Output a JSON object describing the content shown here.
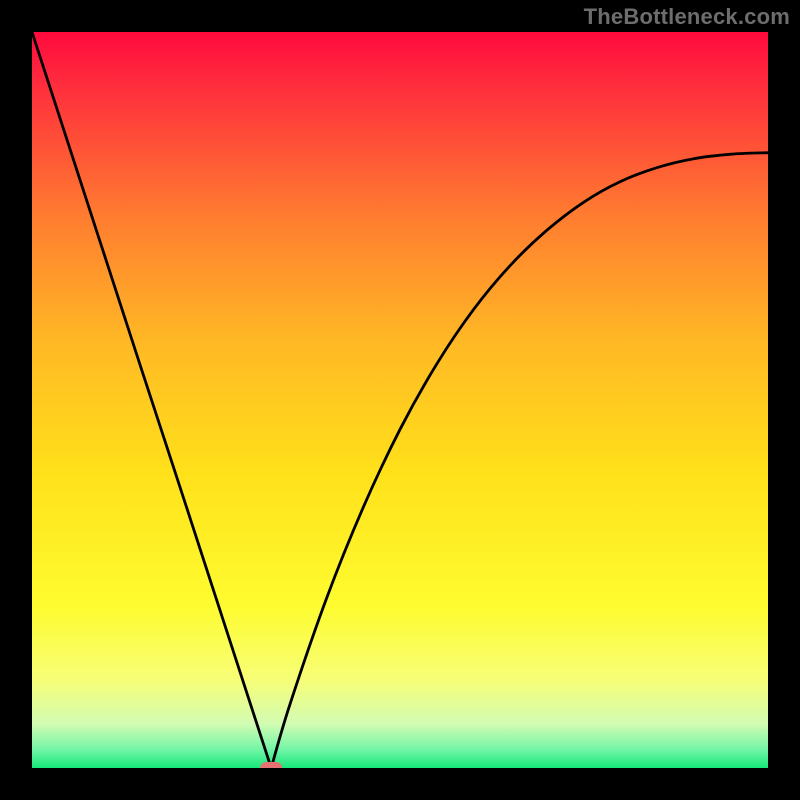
{
  "watermark": "TheBottleneck.com",
  "chart_data": {
    "type": "line",
    "title": "",
    "xlabel": "",
    "ylabel": "",
    "xlim": [
      0,
      1
    ],
    "ylim": [
      0,
      1
    ],
    "vertex_x": 0.325,
    "x": [
      0.0,
      0.05,
      0.1,
      0.15,
      0.2,
      0.25,
      0.3,
      0.325,
      0.35,
      0.4,
      0.45,
      0.5,
      0.55,
      0.6,
      0.65,
      0.7,
      0.75,
      0.8,
      0.85,
      0.9,
      0.95,
      1.0
    ],
    "values": [
      1.0,
      0.846,
      0.692,
      0.538,
      0.385,
      0.231,
      0.077,
      0.0,
      0.085,
      0.23,
      0.354,
      0.46,
      0.549,
      0.623,
      0.683,
      0.731,
      0.769,
      0.797,
      0.816,
      0.828,
      0.834,
      0.836
    ],
    "axes_visible": false,
    "legend": false,
    "background": "vertical-gradient",
    "gradient_stops": [
      {
        "offset": 0.0,
        "color": "#ff0a3d"
      },
      {
        "offset": 0.07,
        "color": "#ff2c3d"
      },
      {
        "offset": 0.25,
        "color": "#ff7c30"
      },
      {
        "offset": 0.42,
        "color": "#ffb825"
      },
      {
        "offset": 0.6,
        "color": "#ffe11a"
      },
      {
        "offset": 0.78,
        "color": "#fefc30"
      },
      {
        "offset": 0.88,
        "color": "#f7fe77"
      },
      {
        "offset": 0.94,
        "color": "#d2fcb3"
      },
      {
        "offset": 0.975,
        "color": "#73f5a7"
      },
      {
        "offset": 1.0,
        "color": "#15e87a"
      }
    ],
    "marker": {
      "x": 0.325,
      "y": 0.0,
      "color": "#e57373"
    }
  }
}
